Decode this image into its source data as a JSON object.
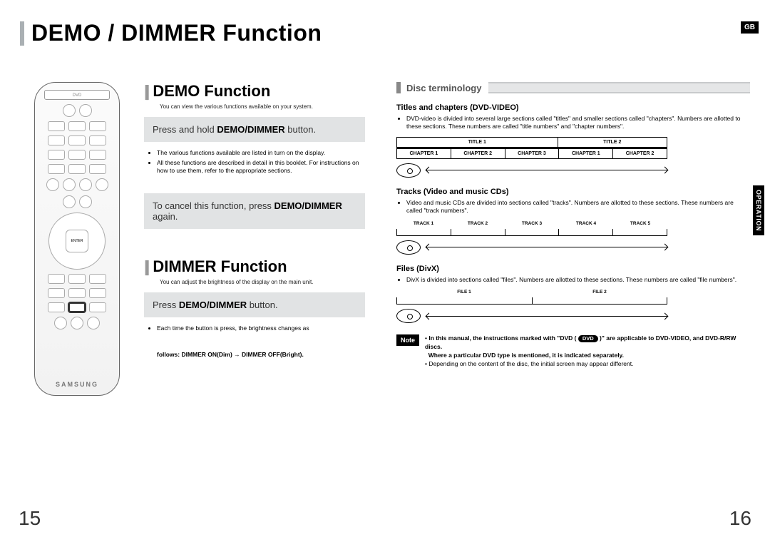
{
  "header": {
    "title": "DEMO / DIMMER Function",
    "lang_badge": "GB",
    "side_tab": "OPERATION"
  },
  "left": {
    "demo": {
      "heading": "DEMO Function",
      "sub": "You can view the various functions available on your system.",
      "step1_pre": "Press and hold ",
      "step1_bold": "DEMO/DIMMER",
      "step1_post": " button.",
      "bullets": [
        "The various functions available are listed in turn on the display.",
        "All these functions are described in detail in this booklet. For instructions on how to use them, refer to the appropriate sections."
      ],
      "cancel_pre": "To cancel this function, press ",
      "cancel_bold": "DEMO/DIMMER",
      "cancel_post": " again."
    },
    "dimmer": {
      "heading": "DIMMER Function",
      "sub": "You can adjust the brightness of the display on the main unit.",
      "step_pre": "Press ",
      "step_bold": "DEMO/DIMMER",
      "step_post": " button.",
      "note_lead": "Each time the button is press, the brightness changes as",
      "note_follows": "follows: DIMMER ON(Dim) → DIMMER OFF(Bright)."
    }
  },
  "right": {
    "heading": "Disc terminology",
    "titles": {
      "h": "Titles and chapters (DVD-VIDEO)",
      "bullets": [
        "DVD-video is divided into several large sections called \"titles\" and smaller sections called \"chapters\". Numbers are allotted to these sections. These numbers are called \"title numbers\" and \"chapter numbers\"."
      ],
      "top_row": [
        "TITLE 1",
        "TITLE 2"
      ],
      "bottom_row": [
        "CHAPTER 1",
        "CHAPTER 2",
        "CHAPTER 3",
        "CHAPTER 1",
        "CHAPTER 2"
      ]
    },
    "tracks": {
      "h": "Tracks (Video and music CDs)",
      "bullets": [
        "Video and music CDs are divided into sections called \"tracks\". Numbers are allotted to these sections. These numbers are called \"track numbers\"."
      ],
      "labels": [
        "TRACK 1",
        "TRACK 2",
        "TRACK 3",
        "TRACK 4",
        "TRACK 5"
      ]
    },
    "files": {
      "h": "Files (DivX)",
      "bullets": [
        "DivX is divided into sections called \"files\". Numbers are allotted to these sections. These numbers are called \"file numbers\"."
      ],
      "labels": [
        "FILE 1",
        "FILE 2"
      ]
    },
    "note": {
      "tag": "Note",
      "line1_pre": "In this manual, the instructions marked with \"DVD ( ",
      "line1_pill": "DVD",
      "line1_post": " )\" are applicable to DVD-VIDEO, and DVD-R/RW discs.",
      "line2": "Where a particular DVD type is mentioned, it is indicated separately.",
      "line3": "Depending on the content of the disc, the initial screen may appear different."
    }
  },
  "remote_brand": "SAMSUNG",
  "pages": {
    "left": "15",
    "right": "16"
  }
}
